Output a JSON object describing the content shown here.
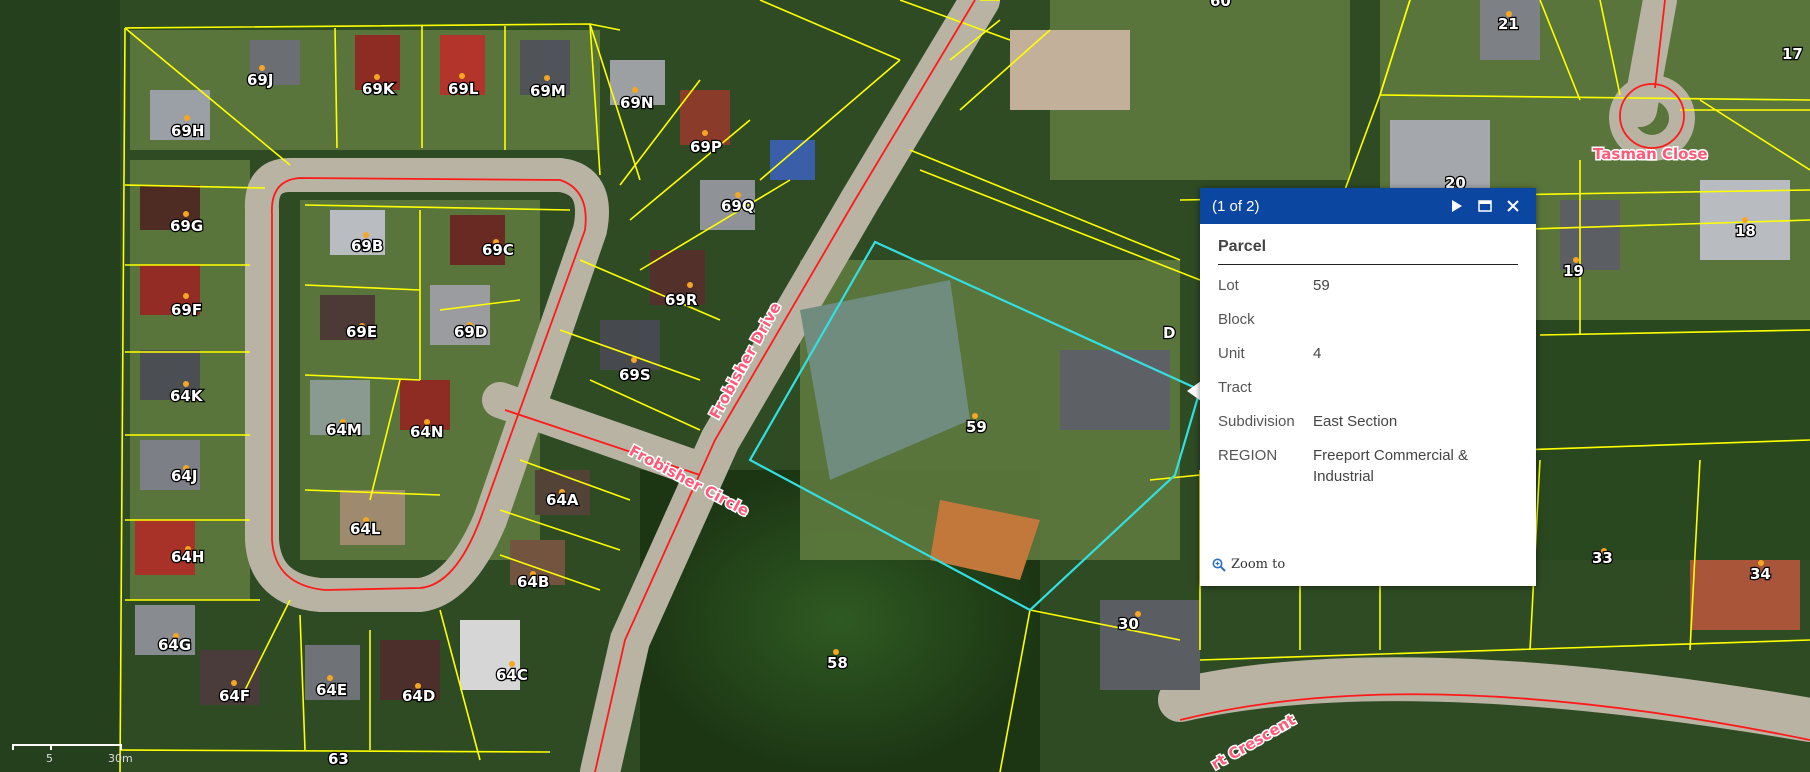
{
  "popup": {
    "counter": "(1 of 2)",
    "heading": "Parcel",
    "fields": [
      {
        "key": "Lot",
        "value": "59"
      },
      {
        "key": "Block",
        "value": ""
      },
      {
        "key": "Unit",
        "value": "4"
      },
      {
        "key": "Tract",
        "value": ""
      },
      {
        "key": "Subdivision",
        "value": "East Section"
      },
      {
        "key": "REGION",
        "value": "Freeport Commercial & Industrial"
      }
    ],
    "zoom_label": "Zoom to"
  },
  "map": {
    "lot_labels": [
      "69J",
      "69K",
      "69L",
      "69M",
      "69N",
      "69P",
      "69Q",
      "69R",
      "69S",
      "69H",
      "69G",
      "69F",
      "64K",
      "64J",
      "64H",
      "64G",
      "64F",
      "64E",
      "64D",
      "64C",
      "64B",
      "64A",
      "64L",
      "64M",
      "64N",
      "69E",
      "69D",
      "69B",
      "69C",
      "59",
      "58",
      "63",
      "60",
      "21",
      "17",
      "20",
      "18",
      "19",
      "D",
      "33",
      "34",
      "30"
    ],
    "street_labels": [
      "Frobisher Drive",
      "Frobisher Circle",
      "Tasman Close",
      "rt Crescent"
    ],
    "scale": {
      "left_label": "5",
      "right_label": "30m"
    }
  },
  "colors": {
    "parcel_lines": "#ffff00",
    "road_lines": "#ff1a1a",
    "selected_parcel": "#33e0e0",
    "popup_header": "#0b47a1"
  }
}
